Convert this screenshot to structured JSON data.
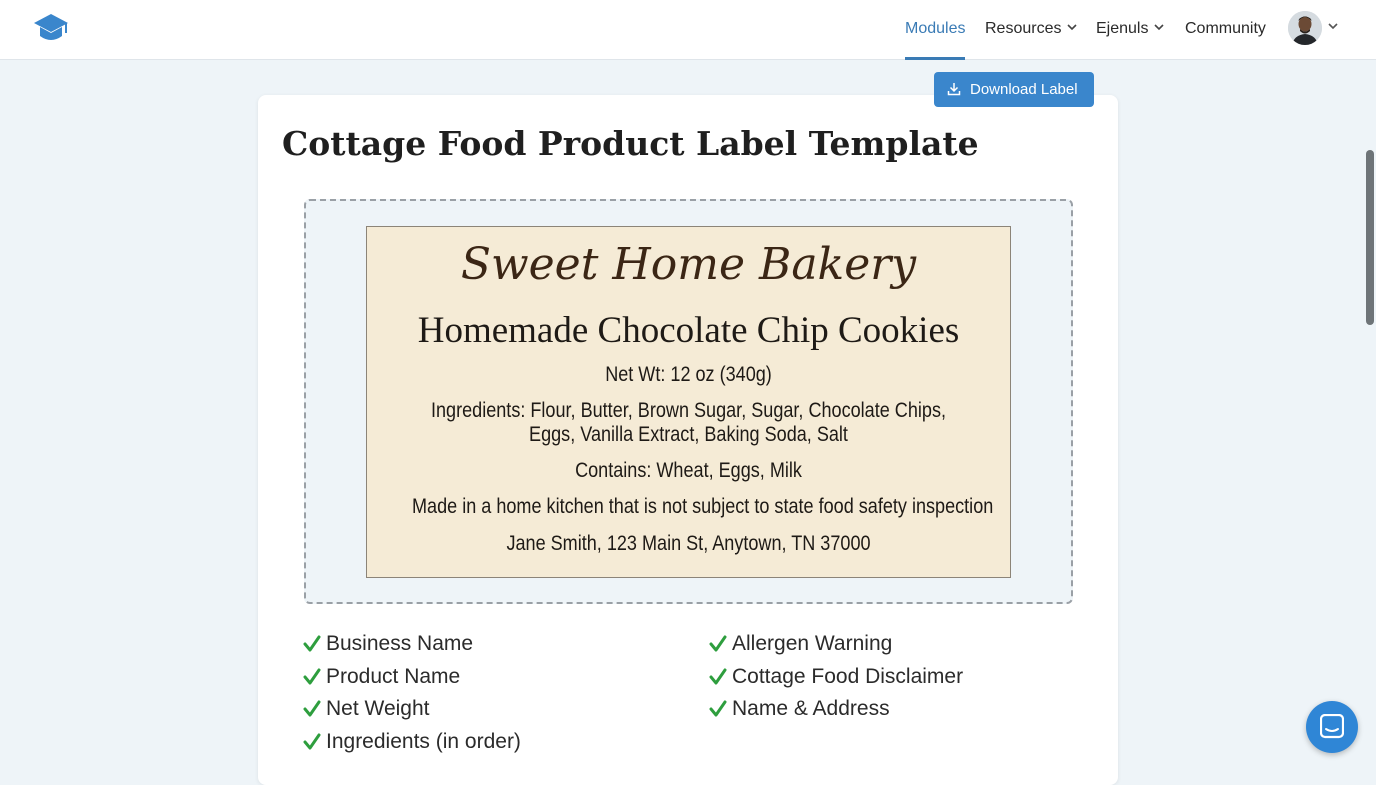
{
  "nav": {
    "items": [
      {
        "label": "Modules",
        "active": true,
        "dropdown": false
      },
      {
        "label": "Resources",
        "active": false,
        "dropdown": true
      },
      {
        "label": "Ejenuls",
        "active": false,
        "dropdown": true
      },
      {
        "label": "Community",
        "active": false,
        "dropdown": false
      }
    ],
    "logo_icon": "graduation-cap-icon",
    "avatar_icon": "user-avatar",
    "accent_color": "#3a7bb5"
  },
  "toolbar": {
    "download_label": "Download Label",
    "download_icon": "download-icon",
    "button_color": "#3a86cc"
  },
  "page": {
    "title": "Cottage Food Product Label Template"
  },
  "label": {
    "business_name": "Sweet Home Bakery",
    "product_name": "Homemade Chocolate Chip Cookies",
    "net_weight": "Net Wt: 12 oz (340g)",
    "ingredients_line1": "Ingredients: Flour, Butter, Brown Sugar, Sugar, Chocolate Chips,",
    "ingredients_line2": "Eggs, Vanilla Extract, Baking Soda, Salt",
    "allergens": "Contains: Wheat, Eggs, Milk",
    "disclaimer": "Made in a home kitchen that is not subject to state food safety inspection",
    "address": "Jane Smith, 123 Main St, Anytown, TN 37000",
    "background_color": "#f5ebd6"
  },
  "checklist": {
    "check_color": "#2e9e3e",
    "left": [
      "Business Name",
      "Product Name",
      "Net Weight",
      "Ingredients (in order)"
    ],
    "right": [
      "Allergen Warning",
      "Cottage Food Disclaimer",
      "Name & Address"
    ]
  },
  "chat": {
    "icon": "chat-icon"
  }
}
